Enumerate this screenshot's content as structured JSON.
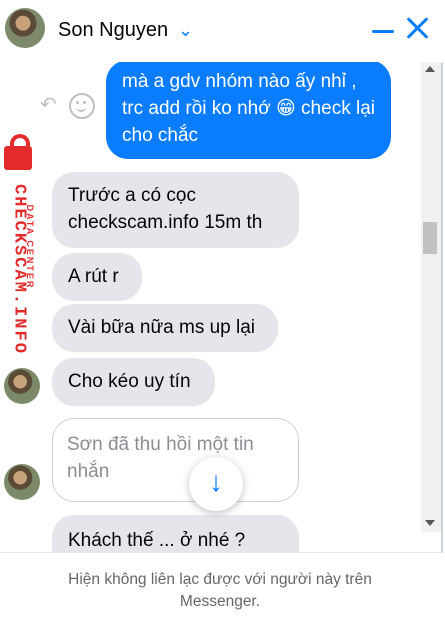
{
  "header": {
    "contact_name": "Son Nguyen",
    "chevron_icon": "chevron-down-icon",
    "minimize_icon": "minus-icon",
    "close_icon": "close-icon"
  },
  "watermark": {
    "main_text": "CHECKSCAM.INFO",
    "sub_text": "DATA CENTER"
  },
  "messages": {
    "outgoing_1": "mà a gdv nhóm nào ấy nhỉ , trc add rồi ko nhớ 😁 check lại cho chắc",
    "incoming_1": "Trước a có cọc checkscam.info 15m th",
    "incoming_2": "A rút r",
    "incoming_3": "Vài bữa nữa ms up lại",
    "incoming_4": "Cho kéo uy tín",
    "recalled": "Sơn đã thu hồi một tin nhắn",
    "incoming_5_partial": "Khách thế ... ở nhé ?"
  },
  "footer": {
    "notice": "Hiện không liên lạc được với người này trên Messenger."
  },
  "colors": {
    "accent": "#0a7cff",
    "incoming_bubble": "#e4e6eb",
    "watermark": "#e32b2b"
  }
}
